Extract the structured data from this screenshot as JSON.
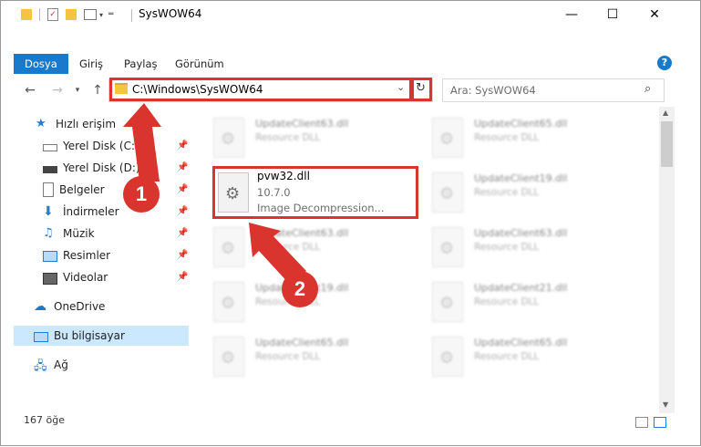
{
  "window": {
    "title": "SysWOW64",
    "minimize": "—",
    "maximize": "☐",
    "close": "✕"
  },
  "ribbon": {
    "tabs": [
      "Dosya",
      "Giriş",
      "Paylaş",
      "Görünüm"
    ],
    "help": "?"
  },
  "address": {
    "path": "C:\\Windows\\SysWOW64",
    "refresh": "↻",
    "search_placeholder": "Ara: SysWOW64"
  },
  "sidebar": {
    "items": [
      {
        "label": "Hızlı erişim",
        "icon": "star-icon"
      },
      {
        "label": "Yerel Disk (C:)",
        "icon": "drive-icon",
        "pinned": true
      },
      {
        "label": "Yerel Disk (D:)",
        "icon": "drive-icon",
        "pinned": true
      },
      {
        "label": "Belgeler",
        "icon": "documents-icon",
        "pinned": true
      },
      {
        "label": "İndirmeler",
        "icon": "downloads-icon",
        "pinned": true
      },
      {
        "label": "Müzik",
        "icon": "music-icon",
        "pinned": true
      },
      {
        "label": "Resimler",
        "icon": "pictures-icon",
        "pinned": true
      },
      {
        "label": "Videolar",
        "icon": "videos-icon",
        "pinned": true
      },
      {
        "label": "OneDrive",
        "icon": "cloud-icon"
      },
      {
        "label": "Bu bilgisayar",
        "icon": "computer-icon",
        "selected": true
      },
      {
        "label": "Ağ",
        "icon": "network-icon"
      }
    ]
  },
  "files": [
    {
      "name": "UpdateClient63.dll",
      "type": "Resource DLL"
    },
    {
      "name": "UpdateClient65.dll",
      "type": "Resource DLL"
    },
    {
      "name": "UpdateClient19.dll",
      "type": "Resource DLL"
    },
    {
      "name": "UpdateClient63.dll",
      "type": "Resource DLL"
    },
    {
      "name": "UpdateClient63.dll",
      "type": "Resource DLL"
    },
    {
      "name": "UpdateClient19.dll",
      "type": "Resource DLL"
    },
    {
      "name": "UpdateClient21.dll",
      "type": "Resource DLL"
    },
    {
      "name": "UpdateClient65.dll",
      "type": "Resource DLL"
    },
    {
      "name": "UpdateClient65.dll",
      "type": "Resource DLL"
    }
  ],
  "highlighted_file": {
    "name": "pvw32.dll",
    "version": "10.7.0",
    "description": "Image Decompression..."
  },
  "status": {
    "count": "167 öğe"
  },
  "annotations": {
    "step1": "1",
    "step2": "2",
    "color": "#d9342e"
  }
}
